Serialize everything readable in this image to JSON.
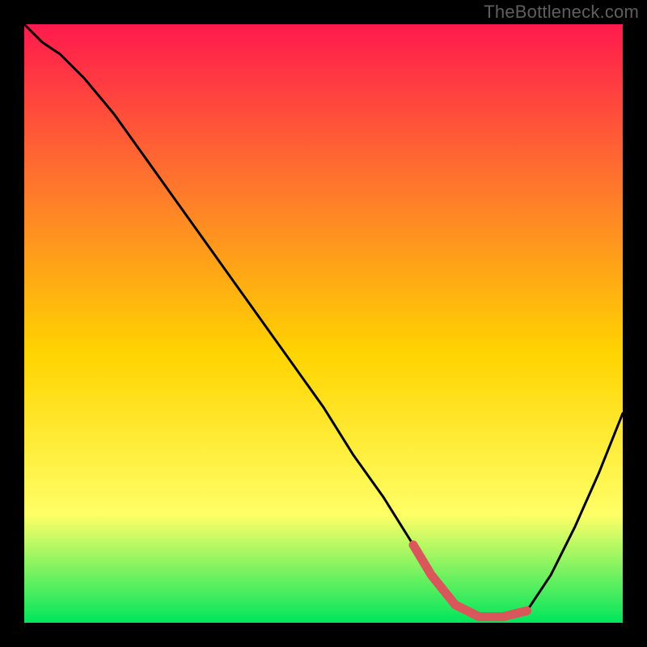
{
  "watermark": "TheBottleneck.com",
  "colors": {
    "frame": "#000000",
    "watermark_text": "#5f5f5f",
    "gradient_top": "#ff1a4d",
    "gradient_mid_upper": "#ff7a2b",
    "gradient_mid": "#ffd400",
    "gradient_mid_lower": "#ffff66",
    "gradient_bottom": "#00e65c",
    "curve": "#000000",
    "highlight": "#d9565a"
  },
  "chart_data": {
    "type": "line",
    "title": "",
    "xlabel": "",
    "ylabel": "",
    "xlim": [
      0,
      100
    ],
    "ylim": [
      0,
      100
    ],
    "series": [
      {
        "name": "bottleneck-curve",
        "x": [
          0,
          3,
          6,
          10,
          15,
          20,
          25,
          30,
          35,
          40,
          45,
          50,
          55,
          60,
          65,
          68,
          72,
          76,
          80,
          84,
          88,
          92,
          96,
          100
        ],
        "values": [
          100,
          97,
          95,
          91,
          85,
          78,
          71,
          64,
          57,
          50,
          43,
          36,
          28,
          21,
          13,
          8,
          3,
          1,
          1,
          2,
          8,
          16,
          25,
          35
        ]
      }
    ],
    "highlight_region": {
      "x_start": 65,
      "x_end": 84
    },
    "annotations": []
  }
}
